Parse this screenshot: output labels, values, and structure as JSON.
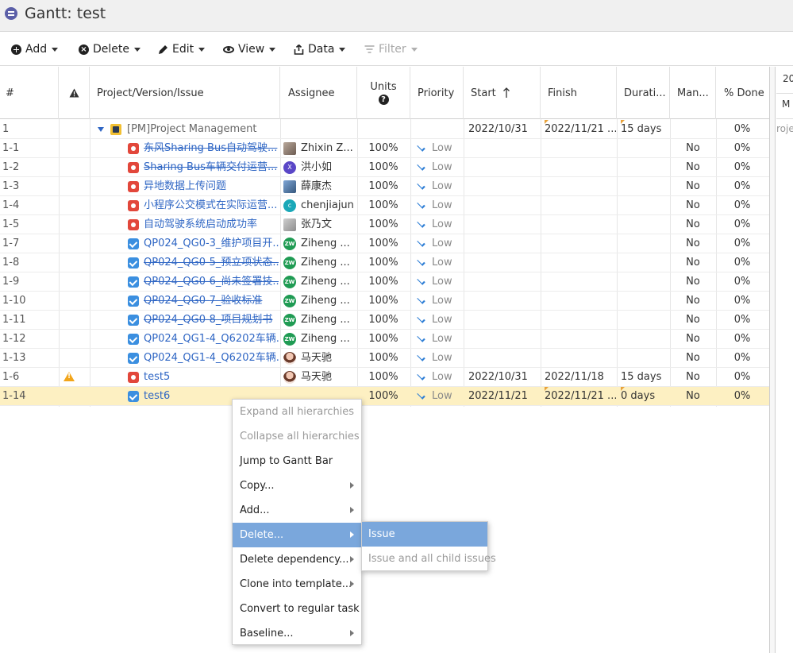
{
  "window": {
    "title": "Gantt:  test"
  },
  "toolbar": {
    "add": "Add",
    "delete": "Delete",
    "edit": "Edit",
    "view": "View",
    "data": "Data",
    "filter": "Filter"
  },
  "columns": {
    "num": "#",
    "issue": "Project/Version/Issue",
    "assignee": "Assignee",
    "units": "Units",
    "priority": "Priority",
    "start": "Start",
    "finish": "Finish",
    "duration": "Durati...",
    "manual": "Man...",
    "done": "% Done"
  },
  "gantt": {
    "header_year": "20",
    "header_day": "M",
    "row_label": "roje"
  },
  "rows": [
    {
      "num": "1",
      "type": "project",
      "issue": "[PM]Project Management",
      "assignee": "",
      "avatar": "",
      "units": "",
      "priority": "",
      "start": "2022/10/31",
      "finish": "2022/11/21 ...",
      "duration": "15 days",
      "manual": "",
      "done": "0%"
    },
    {
      "num": "1-1",
      "type": "bug",
      "issue": "东风Sharing Bus自动驾驶...",
      "assignee": "Zhixin Z...",
      "avatar": "photo",
      "units": "100%",
      "priority": "Low",
      "start": "",
      "finish": "",
      "duration": "",
      "manual": "No",
      "done": "0%"
    },
    {
      "num": "1-2",
      "type": "bug",
      "issue": "Sharing Bus车辆交付运营...",
      "assignee": "洪小如",
      "avatar": "X",
      "units": "100%",
      "priority": "Low",
      "start": "",
      "finish": "",
      "duration": "",
      "manual": "No",
      "done": "0%"
    },
    {
      "num": "1-3",
      "type": "bug",
      "issue": "异地数据上传问题",
      "assignee": "薛康杰",
      "avatar": "blue",
      "units": "100%",
      "priority": "Low",
      "start": "",
      "finish": "",
      "duration": "",
      "manual": "No",
      "done": "0%"
    },
    {
      "num": "1-4",
      "type": "bug",
      "issue": "小程序公交模式在实际运营...",
      "assignee": "chenjiajun",
      "avatar": "C",
      "units": "100%",
      "priority": "Low",
      "start": "",
      "finish": "",
      "duration": "",
      "manual": "No",
      "done": "0%"
    },
    {
      "num": "1-5",
      "type": "bug",
      "issue": "自动驾驶系统启动成功率",
      "assignee": "张乃文",
      "avatar": "gray",
      "units": "100%",
      "priority": "Low",
      "start": "",
      "finish": "",
      "duration": "",
      "manual": "No",
      "done": "0%"
    },
    {
      "num": "1-7",
      "type": "task",
      "issue": "QP024_QG0-3_维护项目开...",
      "assignee": "Ziheng ...",
      "avatar": "ZW",
      "units": "100%",
      "priority": "Low",
      "start": "",
      "finish": "",
      "duration": "",
      "manual": "No",
      "done": "0%"
    },
    {
      "num": "1-8",
      "type": "task",
      "issue": "QP024_QG0-5_预立项状态...",
      "assignee": "Ziheng ...",
      "avatar": "ZW",
      "units": "100%",
      "priority": "Low",
      "start": "",
      "finish": "",
      "duration": "",
      "manual": "No",
      "done": "0%"
    },
    {
      "num": "1-9",
      "type": "task",
      "issue": "QP024_QG0-6_尚未签署技...",
      "assignee": "Ziheng ...",
      "avatar": "ZW",
      "units": "100%",
      "priority": "Low",
      "start": "",
      "finish": "",
      "duration": "",
      "manual": "No",
      "done": "0%"
    },
    {
      "num": "1-10",
      "type": "task",
      "issue": "QP024_QG0-7_验收标准",
      "assignee": "Ziheng ...",
      "avatar": "ZW",
      "units": "100%",
      "priority": "Low",
      "start": "",
      "finish": "",
      "duration": "",
      "manual": "No",
      "done": "0%"
    },
    {
      "num": "1-11",
      "type": "task",
      "issue": "QP024_QG0-8_项目规划书",
      "assignee": "Ziheng ...",
      "avatar": "ZW",
      "units": "100%",
      "priority": "Low",
      "start": "",
      "finish": "",
      "duration": "",
      "manual": "No",
      "done": "0%"
    },
    {
      "num": "1-12",
      "type": "task",
      "issue": "QP024_QG1-4_Q6202车辆...",
      "assignee": "Ziheng ...",
      "avatar": "ZW",
      "units": "100%",
      "priority": "Low",
      "start": "",
      "finish": "",
      "duration": "",
      "manual": "No",
      "done": "0%"
    },
    {
      "num": "1-13",
      "type": "task",
      "issue": "QP024_QG1-4_Q6202车辆...",
      "assignee": "马天驰",
      "avatar": "woman",
      "units": "100%",
      "priority": "Low",
      "start": "",
      "finish": "",
      "duration": "",
      "manual": "No",
      "done": "0%"
    },
    {
      "num": "1-6",
      "type": "bug",
      "issue": "test5",
      "assignee": "马天驰",
      "avatar": "woman",
      "units": "100%",
      "priority": "Low",
      "start": "2022/10/31",
      "finish": "2022/11/18",
      "duration": "15 days",
      "manual": "No",
      "done": "0%"
    },
    {
      "num": "1-14",
      "type": "task",
      "issue": "test6",
      "assignee": "",
      "avatar": "",
      "units": "100%",
      "priority": "Low",
      "start": "2022/11/21",
      "finish": "2022/11/21 ...",
      "duration": "0 days",
      "manual": "No",
      "done": "0%"
    }
  ],
  "context_menu": {
    "items": [
      "Expand all hierarchies",
      "Collapse all hierarchies",
      "Jump to Gantt Bar",
      "Copy...",
      "Add...",
      "Delete...",
      "Delete dependency...",
      "Clone into template...",
      "Convert to regular task",
      "Baseline..."
    ],
    "submenu": [
      "Issue",
      "Issue and all child issues"
    ]
  },
  "colors": {
    "link": "#2f66c4",
    "selected_row": "#fdf0c2",
    "menu_highlight": "#7aa7dc",
    "bug": "#e2473b",
    "task": "#3b8fe0",
    "warning": "#f2a51a"
  }
}
